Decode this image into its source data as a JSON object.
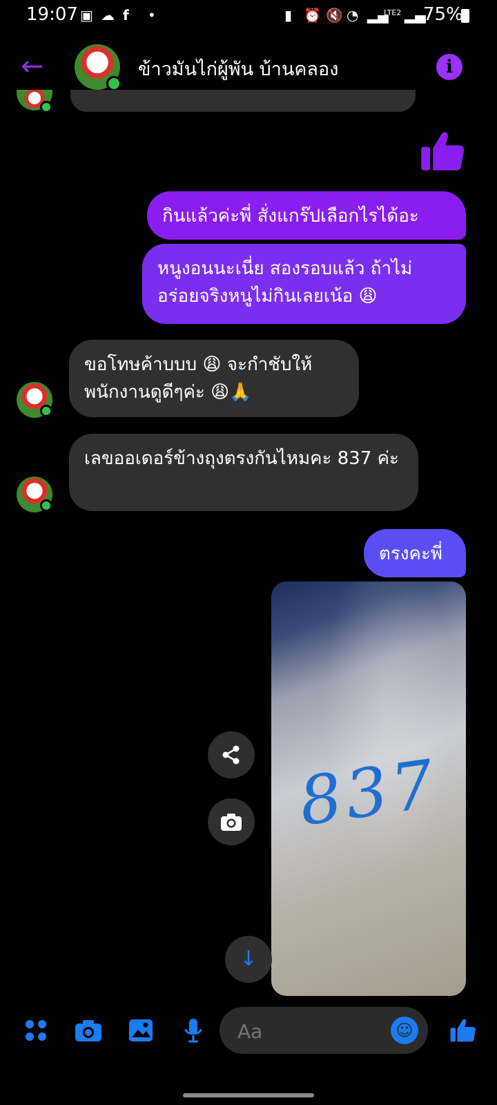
{
  "status_bar": {
    "time": "19:07",
    "battery": "75%",
    "icons": [
      "image-icon",
      "cloud-icon",
      "facebook-icon",
      "dot-icon",
      "battery-saver-icon",
      "alarm-icon",
      "mute-icon",
      "wifi-icon",
      "signal-icon",
      "lte-icon",
      "signal-icon",
      "battery-icon"
    ]
  },
  "header": {
    "title": "ข้าวมันไก่ผู้พัน บ้านคลอง",
    "back_icon": "arrow-left-icon",
    "info_glyph": "i"
  },
  "messages": [
    {
      "id": "m1",
      "from": "me",
      "text": "กินแล้วค่ะพี่ สั่งแกร๊ปเลือกไรได้อะ"
    },
    {
      "id": "m2",
      "from": "me",
      "text": "หนูงอนนะเนี่ย สองรอบแล้ว ถ้าไม่อร่อยจริงหนูไม่กินเลยเน้อ 😩"
    },
    {
      "id": "m3",
      "from": "shop",
      "text": "ขอโทษค้าบบบ 😩 จะกำชับให้พนักงานดูดีๆค่ะ 😩🙏"
    },
    {
      "id": "m4",
      "from": "shop",
      "text": "เลขออเดอร์ข้างถุงตรงกันไหมคะ 837 ค่ะ"
    },
    {
      "id": "m5",
      "from": "me",
      "text": "ตรงคะพี่"
    }
  ],
  "photo": {
    "handwritten": "837"
  },
  "composer": {
    "placeholder": "Aa"
  },
  "colors": {
    "accent_purple": "#8a1ef0",
    "messenger_blue": "#1a7bf2",
    "incoming_bubble": "#303030",
    "online_green": "#33c24a"
  }
}
